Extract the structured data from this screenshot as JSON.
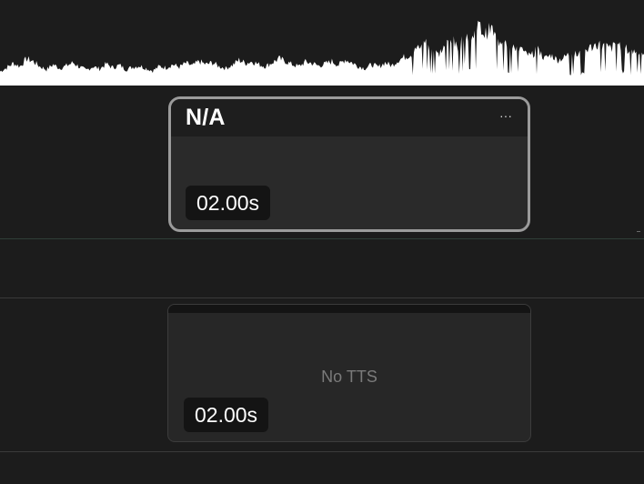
{
  "waveform": {
    "color": "#ffffff",
    "peaks": [
      0.22,
      0.28,
      0.35,
      0.3,
      0.42,
      0.38,
      0.3,
      0.25,
      0.33,
      0.27,
      0.31,
      0.36,
      0.29,
      0.24,
      0.3,
      0.26,
      0.34,
      0.28,
      0.32,
      0.25,
      0.29,
      0.31,
      0.27,
      0.23,
      0.3,
      0.28,
      0.33,
      0.29,
      0.35,
      0.31,
      0.38,
      0.33,
      0.36,
      0.3,
      0.27,
      0.32,
      0.4,
      0.35,
      0.38,
      0.33,
      0.3,
      0.36,
      0.42,
      0.38,
      0.33,
      0.3,
      0.37,
      0.35,
      0.31,
      0.34,
      0.38,
      0.32,
      0.41,
      0.36,
      0.3,
      0.27,
      0.33,
      0.29,
      0.36,
      0.31,
      0.4,
      0.45,
      0.5,
      0.6,
      0.72,
      0.58,
      0.48,
      0.62,
      0.75,
      0.55,
      0.85,
      0.7,
      0.95,
      0.8,
      0.9,
      0.68,
      0.75,
      0.55,
      0.62,
      0.5,
      0.46,
      0.58,
      0.42,
      0.48,
      0.4,
      0.44,
      0.52,
      0.47,
      0.55,
      0.6,
      0.65,
      0.62,
      0.58,
      0.66,
      0.6,
      0.52,
      0.56,
      0.5
    ]
  },
  "clips": {
    "selected": {
      "title": "N/A",
      "more_icon": "more-horizontal-icon",
      "more_glyph": "···",
      "duration": "02.00s"
    },
    "tts": {
      "status": "No TTS",
      "duration": "02.00s"
    }
  },
  "colors": {
    "background": "#1c1c1c",
    "selected_border": "#9b9b9b",
    "clip_body": "#2a2a2a",
    "badge": "#141414",
    "separator_green": "#2f3f38"
  }
}
